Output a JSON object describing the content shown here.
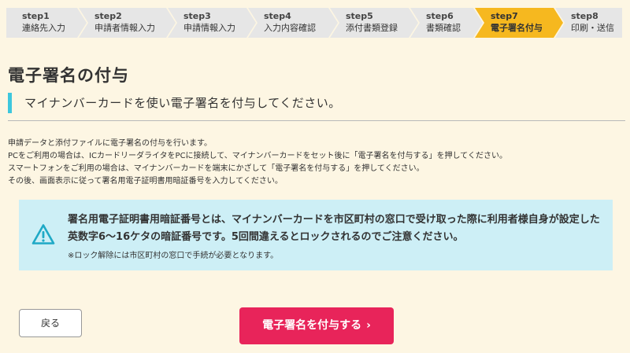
{
  "steps": [
    {
      "num": "step1",
      "label": "連絡先入力"
    },
    {
      "num": "step2",
      "label": "申請者情報入力"
    },
    {
      "num": "step3",
      "label": "申請情報入力"
    },
    {
      "num": "step4",
      "label": "入力内容確認"
    },
    {
      "num": "step5",
      "label": "添付書類登録"
    },
    {
      "num": "step6",
      "label": "書類確認"
    },
    {
      "num": "step7",
      "label": "電子署名付与",
      "active": true
    },
    {
      "num": "step8",
      "label": "印刷・送信"
    }
  ],
  "page": {
    "title": "電子署名の付与",
    "subtitle": "マイナンバーカードを使い電子署名を付与してください。",
    "description": [
      "申請データと添付ファイルに電子署名の付与を行います。",
      "PCをご利用の場合は、ICカードリーダライタをPCに接続して、マイナンバーカードをセット後に「電子署名を付与する」を押してください。",
      "スマートフォンをご利用の場合は、マイナンバーカードを端末にかざして「電子署名を付与する」を押してください。",
      "その後、画面表示に従って署名用電子証明書用暗証番号を入力してください。"
    ]
  },
  "notice": {
    "icon": "warning-icon",
    "main": "署名用電子証明書用暗証番号とは、マイナンバーカードを市区町村の窓口で受け取った際に利用者様自身が設定した英数字6～16ケタの暗証番号です。5回間違えるとロックされるのでご注意ください。",
    "sub": "※ロック解除には市区町村の窓口で手続が必要となります。"
  },
  "buttons": {
    "back": "戻る",
    "sign": "電子署名を付与する",
    "sign_icon": "chevron-right-icon"
  },
  "colors": {
    "background": "#fdf6e3",
    "active_step": "#f6b81f",
    "accent": "#3ec7dd",
    "notice_bg": "#cdeff6",
    "primary_button": "#e8245a"
  }
}
